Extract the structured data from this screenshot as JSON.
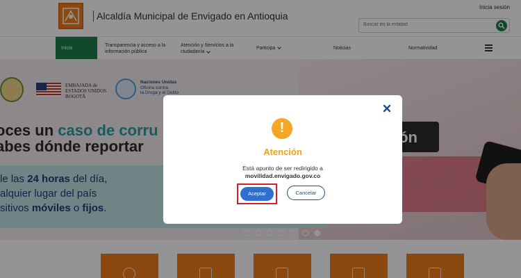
{
  "header": {
    "site_title": "Alcaldía Municipal de Envigado en Antioquia",
    "login_label": "Inicia sesión",
    "search_placeholder": "Buscar en la entidad"
  },
  "nav": {
    "items": [
      {
        "label": "Inicio",
        "active": true
      },
      {
        "label": "Transparencia y acceso a la información pública"
      },
      {
        "label": "Atención y Servicios a la ciudadanía"
      },
      {
        "label": "Participa"
      },
      {
        "label": "Noticias"
      },
      {
        "label": "Normatividad"
      }
    ]
  },
  "banner": {
    "embassy_text": [
      "EMBAJADA de",
      "ESTADOS UNIDOS",
      "BOGOTÁ"
    ],
    "un_text": [
      "Naciones Unidas",
      "Oficina contra",
      "la Droga y el Delito"
    ],
    "headline_line1_a": "oces un ",
    "headline_line1_b": "caso de corru",
    "headline_line2": "abes dónde reportar",
    "dark_box_text": "ión",
    "sub_line1_a": "le las ",
    "sub_line1_b": "24 horas",
    "sub_line1_c": " del día,",
    "sub_line2": "alquier lugar del país",
    "sub_line3_a": "sitivos ",
    "sub_line3_b": "móviles",
    "sub_line3_c": " o ",
    "sub_line3_d": "fijos",
    "sub_line3_e": ".",
    "slide_count": 7,
    "active_slide": 7
  },
  "modal": {
    "title": "Atención",
    "message": "Está apunto de ser redirigido a",
    "url": "movilidad.envigado.gov.co",
    "accept_label": "Aceptar",
    "cancel_label": "Cancelar",
    "icon": "warning-icon"
  },
  "colors": {
    "brand_green": "#1d7f4a",
    "brand_orange": "#f07d1a",
    "accept_blue": "#2f6fd1",
    "warning_orange": "#f5a623",
    "highlight_red": "#d0202f"
  }
}
